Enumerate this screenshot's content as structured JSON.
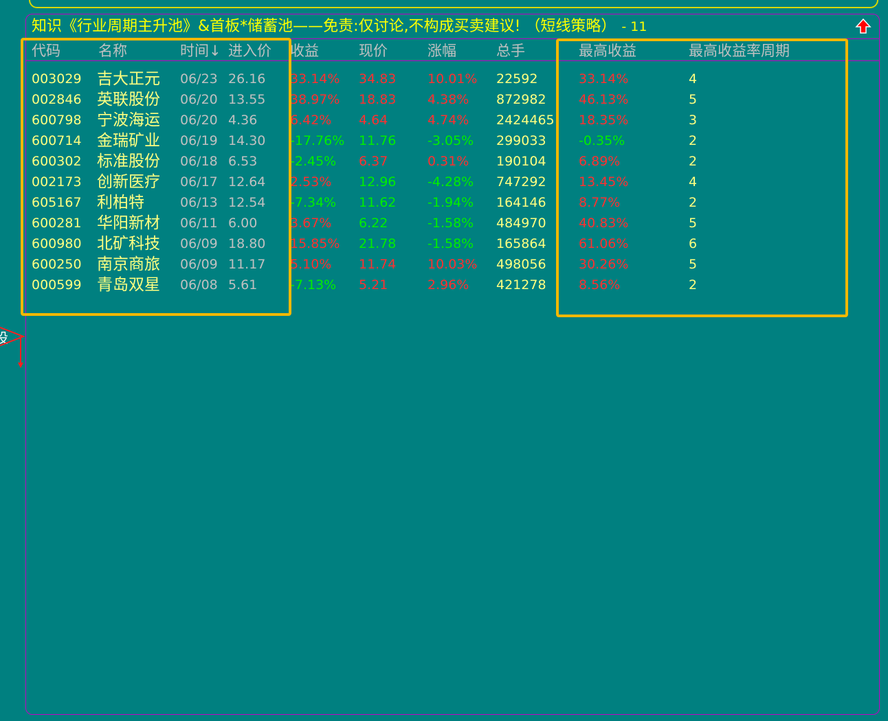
{
  "title": {
    "text": "知识《行业周期主升池》&首板*储蓄池——免责:仅讨论,不构成买卖建议! （短线策略）",
    "count": "- 11"
  },
  "colors": {
    "background": "#008080",
    "code": "#ffff80",
    "name": "#ffff80",
    "header": "#c0c0c0",
    "neutral": "#c0c0c0",
    "up": "#ff3030",
    "down": "#00ee00",
    "volume": "#ffff80",
    "border": "#c400c4",
    "highlight": "#f5b800",
    "arrow": "#ff0000"
  },
  "icons": {
    "up_arrow": "up-arrow-icon",
    "side_arrow": "triangle-right-icon"
  },
  "side_label": "设",
  "columns": [
    "代码",
    "名称",
    "时间↓",
    "进入价",
    "收益",
    "现价",
    "涨幅",
    "总手",
    "最高收益",
    "最高收益率周期"
  ],
  "rows": [
    {
      "code": "003029",
      "name": "吉大正元",
      "time": "06/23",
      "entry": "26.16",
      "ret": "33.14%",
      "retDir": "up",
      "price": "34.83",
      "priceDir": "up",
      "chg": "10.01%",
      "chgDir": "up",
      "vol": "22592",
      "max": "33.14%",
      "maxDir": "up",
      "period": "4"
    },
    {
      "code": "002846",
      "name": "英联股份",
      "time": "06/20",
      "entry": "13.55",
      "ret": "38.97%",
      "retDir": "up",
      "price": "18.83",
      "priceDir": "up",
      "chg": "4.38%",
      "chgDir": "up",
      "vol": "872982",
      "max": "46.13%",
      "maxDir": "up",
      "period": "5"
    },
    {
      "code": "600798",
      "name": "宁波海运",
      "time": "06/20",
      "entry": "4.36",
      "ret": "6.42%",
      "retDir": "up",
      "price": "4.64",
      "priceDir": "up",
      "chg": "4.74%",
      "chgDir": "up",
      "vol": "2424465",
      "max": "18.35%",
      "maxDir": "up",
      "period": "3"
    },
    {
      "code": "600714",
      "name": "金瑞矿业",
      "time": "06/19",
      "entry": "14.30",
      "ret": "-17.76%",
      "retDir": "down",
      "price": "11.76",
      "priceDir": "down",
      "chg": "-3.05%",
      "chgDir": "down",
      "vol": "299033",
      "max": "-0.35%",
      "maxDir": "down",
      "period": "2"
    },
    {
      "code": "600302",
      "name": "标准股份",
      "time": "06/18",
      "entry": "6.53",
      "ret": "-2.45%",
      "retDir": "down",
      "price": "6.37",
      "priceDir": "up",
      "chg": "0.31%",
      "chgDir": "up",
      "vol": "190104",
      "max": "6.89%",
      "maxDir": "up",
      "period": "2"
    },
    {
      "code": "002173",
      "name": "创新医疗",
      "time": "06/17",
      "entry": "12.64",
      "ret": "2.53%",
      "retDir": "up",
      "price": "12.96",
      "priceDir": "down",
      "chg": "-4.28%",
      "chgDir": "down",
      "vol": "747292",
      "max": "13.45%",
      "maxDir": "up",
      "period": "4"
    },
    {
      "code": "605167",
      "name": "利柏特",
      "time": "06/13",
      "entry": "12.54",
      "ret": "-7.34%",
      "retDir": "down",
      "price": "11.62",
      "priceDir": "down",
      "chg": "-1.94%",
      "chgDir": "down",
      "vol": "164146",
      "max": "8.77%",
      "maxDir": "up",
      "period": "2"
    },
    {
      "code": "600281",
      "name": "华阳新材",
      "time": "06/11",
      "entry": "6.00",
      "ret": "3.67%",
      "retDir": "up",
      "price": "6.22",
      "priceDir": "down",
      "chg": "-1.58%",
      "chgDir": "down",
      "vol": "484970",
      "max": "40.83%",
      "maxDir": "up",
      "period": "5"
    },
    {
      "code": "600980",
      "name": "北矿科技",
      "time": "06/09",
      "entry": "18.80",
      "ret": "15.85%",
      "retDir": "up",
      "price": "21.78",
      "priceDir": "down",
      "chg": "-1.58%",
      "chgDir": "down",
      "vol": "165864",
      "max": "61.06%",
      "maxDir": "up",
      "period": "6"
    },
    {
      "code": "600250",
      "name": "南京商旅",
      "time": "06/09",
      "entry": "11.17",
      "ret": "5.10%",
      "retDir": "up",
      "price": "11.74",
      "priceDir": "up",
      "chg": "10.03%",
      "chgDir": "up",
      "vol": "498056",
      "max": "30.26%",
      "maxDir": "up",
      "period": "5"
    },
    {
      "code": "000599",
      "name": "青岛双星",
      "time": "06/08",
      "entry": "5.61",
      "ret": "-7.13%",
      "retDir": "down",
      "price": "5.21",
      "priceDir": "up",
      "chg": "2.96%",
      "chgDir": "up",
      "vol": "421278",
      "max": "8.56%",
      "maxDir": "up",
      "period": "2"
    }
  ]
}
